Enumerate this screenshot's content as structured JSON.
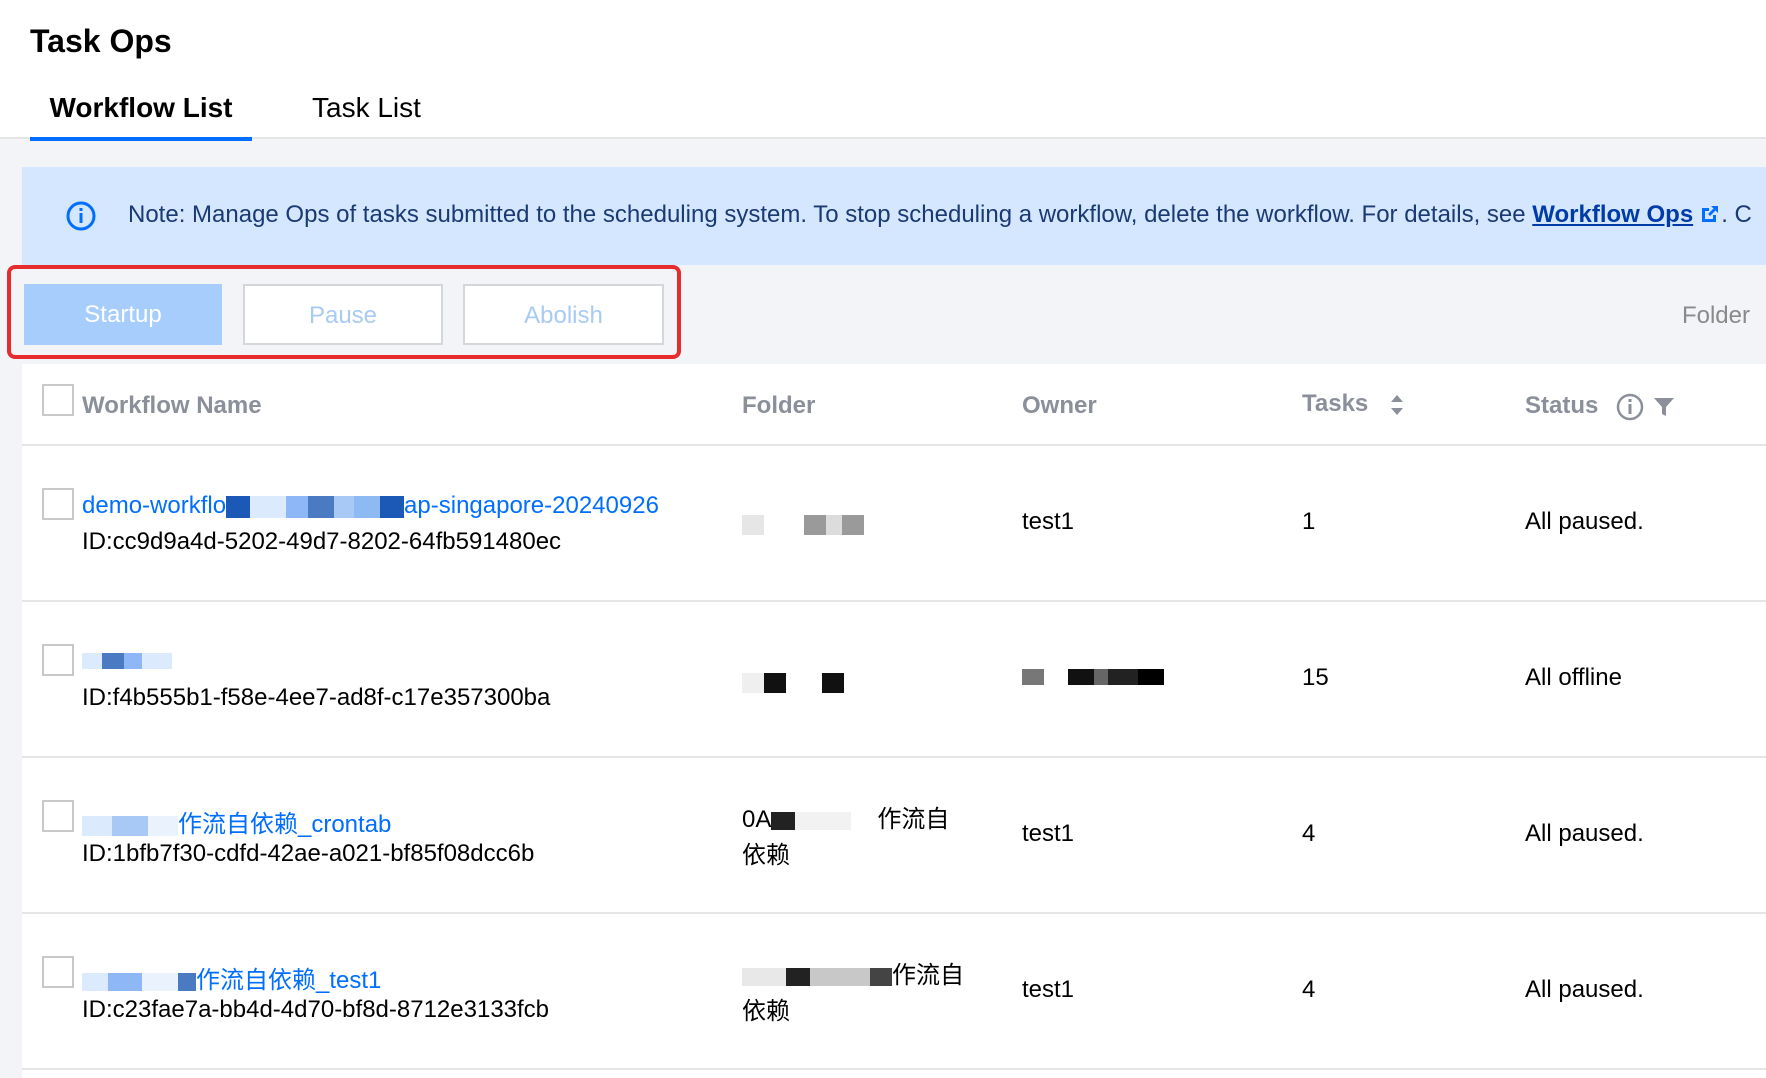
{
  "header": {
    "title": "Task Ops",
    "tabs": [
      {
        "label": "Workflow List",
        "active": true
      },
      {
        "label": "Task List",
        "active": false
      }
    ]
  },
  "notice": {
    "icon": "info-icon",
    "text": "Note: Manage Ops of tasks submitted to the scheduling system. To stop scheduling a workflow, delete the workflow. For details, see ",
    "link_label": "Workflow Ops",
    "link_icon": "external-link-icon",
    "trailing": ". C"
  },
  "toolbar": {
    "startup_label": "Startup",
    "pause_label": "Pause",
    "abolish_label": "Abolish",
    "folder_filter_label": "Folder"
  },
  "table": {
    "columns": {
      "name": "Workflow Name",
      "folder": "Folder",
      "owner": "Owner",
      "tasks": "Tasks",
      "status": "Status"
    },
    "rows": [
      {
        "name_prefix": "demo-workflo",
        "name_suffix": "ap-singapore-20240926",
        "id": "ID:cc9d9a4d-5202-49d7-8202-64fb591480ec",
        "owner": "test1",
        "tasks": "1",
        "status": "All paused."
      },
      {
        "name_prefix": "",
        "name_suffix": "",
        "id": "ID:f4b555b1-f58e-4ee7-ad8f-c17e357300ba",
        "owner": "",
        "tasks": "15",
        "status": "All offline"
      },
      {
        "name_prefix": "",
        "name_suffix": "作流自依赖_crontab",
        "id": "ID:1bfb7f30-cdfd-42ae-a021-bf85f08dcc6b",
        "folder_line1_prefix": "0A",
        "folder_line1_suffix": "作流自",
        "folder_line2": "依赖",
        "owner": "test1",
        "tasks": "4",
        "status": "All paused."
      },
      {
        "name_prefix": "",
        "name_suffix": "作流自依赖_test1",
        "id": "ID:c23fae7a-bb4d-4d70-bf8d-8712e3133fcb",
        "folder_line1_prefix": "",
        "folder_line1_suffix": "作流自",
        "folder_line2": "依赖",
        "owner": "test1",
        "tasks": "4",
        "status": "All paused."
      }
    ]
  },
  "colors": {
    "primary": "#006eff",
    "notice_bg": "#d5e7ff",
    "highlight": "#e62c2c",
    "disabled_primary": "#a6cdfc"
  }
}
